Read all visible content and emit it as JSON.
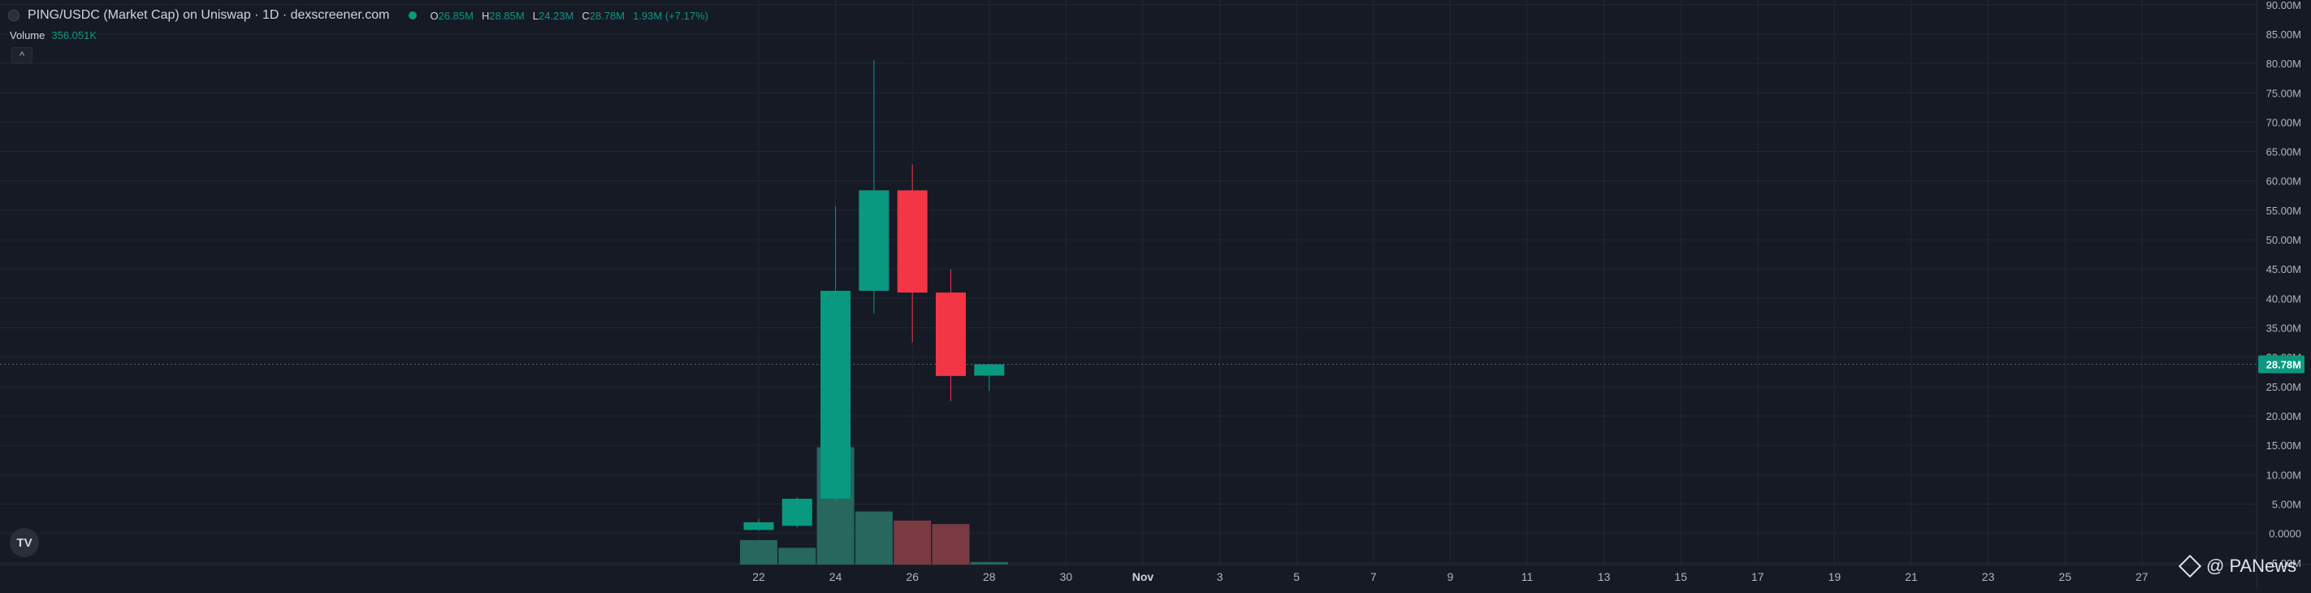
{
  "header": {
    "title": "PING/USDC (Market Cap) on Uniswap · 1D · dexscreener.com",
    "ohlc": [
      {
        "key": "O",
        "value": "26.85M"
      },
      {
        "key": "H",
        "value": "28.85M"
      },
      {
        "key": "L",
        "value": "24.23M"
      },
      {
        "key": "C",
        "value": "28.78M"
      },
      {
        "key": "",
        "value": "1.93M (+7.17%)"
      }
    ]
  },
  "volume": {
    "label": "Volume",
    "value": "356.051K"
  },
  "collapse": {
    "label": "^"
  },
  "price_tag": "28.78M",
  "logo": {
    "text": "TV"
  },
  "watermark": {
    "text": "@ PANews"
  },
  "colors": {
    "background": "#161a25",
    "grid": "#232734",
    "up": "#089981",
    "down": "#f23645",
    "up_volume": "#26675e",
    "down_volume": "#7a3a43",
    "axis_text": "#b2b5be",
    "price_tag": "#089981"
  },
  "chart_data": {
    "type": "candlestick",
    "y_ticks": [
      {
        "value": 90,
        "label": "90.00M"
      },
      {
        "value": 85,
        "label": "85.00M"
      },
      {
        "value": 80,
        "label": "80.00M"
      },
      {
        "value": 75,
        "label": "75.00M"
      },
      {
        "value": 70,
        "label": "70.00M"
      },
      {
        "value": 65,
        "label": "65.00M"
      },
      {
        "value": 60,
        "label": "60.00M"
      },
      {
        "value": 55,
        "label": "55.00M"
      },
      {
        "value": 50,
        "label": "50.00M"
      },
      {
        "value": 45,
        "label": "45.00M"
      },
      {
        "value": 40,
        "label": "40.00M"
      },
      {
        "value": 35,
        "label": "35.00M"
      },
      {
        "value": 30,
        "label": "30.00M"
      },
      {
        "value": 25,
        "label": "25.00M"
      },
      {
        "value": 20,
        "label": "20.00M"
      },
      {
        "value": 15,
        "label": "15.00M"
      },
      {
        "value": 10,
        "label": "10.00M"
      },
      {
        "value": 5,
        "label": "5.00M"
      },
      {
        "value": 0,
        "label": "0.0000"
      },
      {
        "value": -5,
        "label": "-5.00M"
      }
    ],
    "ylim": [
      -5.3,
      90.8
    ],
    "x_ticks": [
      {
        "day": 22,
        "label": "22"
      },
      {
        "day": 24,
        "label": "24"
      },
      {
        "day": 26,
        "label": "26"
      },
      {
        "day": 28,
        "label": "28"
      },
      {
        "day": 30,
        "label": "30"
      },
      {
        "day": 32,
        "label": "Nov"
      },
      {
        "day": 34,
        "label": "3"
      },
      {
        "day": 36,
        "label": "5"
      },
      {
        "day": 38,
        "label": "7"
      },
      {
        "day": 40,
        "label": "9"
      },
      {
        "day": 42,
        "label": "11"
      },
      {
        "day": 44,
        "label": "13"
      },
      {
        "day": 46,
        "label": "15"
      },
      {
        "day": 48,
        "label": "17"
      },
      {
        "day": 50,
        "label": "19"
      },
      {
        "day": 52,
        "label": "21"
      },
      {
        "day": 54,
        "label": "23"
      },
      {
        "day": 56,
        "label": "25"
      },
      {
        "day": 58,
        "label": "27"
      }
    ],
    "candles": [
      {
        "day": 22,
        "open": 0.6,
        "high": 2.5,
        "low": 0.4,
        "close": 1.9,
        "volume": 3.5
      },
      {
        "day": 23,
        "open": 1.3,
        "high": 6.2,
        "low": 1.0,
        "close": 5.9,
        "volume": 2.4
      },
      {
        "day": 24,
        "open": 5.9,
        "high": 55.7,
        "low": 5.5,
        "close": 41.3,
        "volume": 16.8
      },
      {
        "day": 25,
        "open": 41.3,
        "high": 80.6,
        "low": 37.5,
        "close": 58.4,
        "volume": 7.6
      },
      {
        "day": 26,
        "open": 58.4,
        "high": 62.8,
        "low": 32.5,
        "close": 41.0,
        "volume": 6.3
      },
      {
        "day": 27,
        "open": 41.0,
        "high": 45.0,
        "low": 22.5,
        "close": 26.8,
        "volume": 5.8
      },
      {
        "day": 28,
        "open": 26.85,
        "high": 28.85,
        "low": 24.23,
        "close": 28.78,
        "volume": 0.36
      }
    ],
    "last_price": 28.78,
    "volume_max_height": 17.0,
    "grid": true
  }
}
